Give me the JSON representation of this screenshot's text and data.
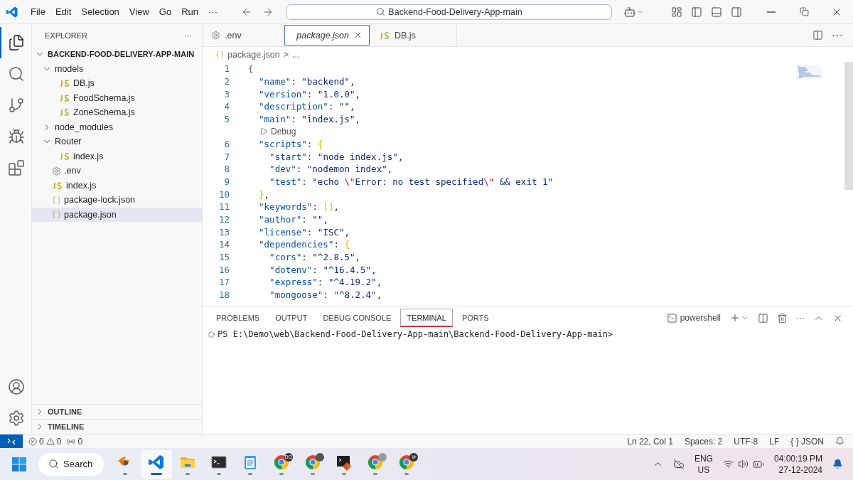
{
  "title_bar": {
    "menu": [
      "File",
      "Edit",
      "Selection",
      "View",
      "Go",
      "Run",
      "···"
    ],
    "search": {
      "value": "Backend-Food-Delivery-App-main"
    }
  },
  "activity_bar": {
    "items": [
      {
        "kind": "files",
        "selected": true
      },
      {
        "kind": "search",
        "selected": false
      },
      {
        "kind": "source-control",
        "selected": false
      },
      {
        "kind": "run-debug",
        "selected": false
      },
      {
        "kind": "extensions",
        "selected": false
      }
    ],
    "bottom": [
      {
        "kind": "account"
      },
      {
        "kind": "settings"
      }
    ]
  },
  "sidebar": {
    "title": "EXPLORER",
    "more": "···",
    "tree": [
      {
        "label": "BACKEND-FOOD-DELIVERY-APP-MAIN",
        "kind": "root",
        "expanded": true,
        "children": [
          {
            "label": "models",
            "kind": "folder",
            "expanded": true,
            "children": [
              {
                "label": "DB.js",
                "kind": "js",
                "selected": false
              },
              {
                "label": "FoodSchema.js",
                "kind": "js",
                "selected": false
              },
              {
                "label": "ZoneSchema.js",
                "kind": "js",
                "selected": false
              }
            ]
          },
          {
            "label": "node_modules",
            "kind": "folder",
            "expanded": false
          },
          {
            "label": "Router",
            "kind": "folder",
            "expanded": true,
            "children": [
              {
                "label": "index.js",
                "kind": "js",
                "selected": false
              }
            ]
          },
          {
            "label": ".env",
            "kind": "env",
            "selected": false
          },
          {
            "label": "index.js",
            "kind": "js",
            "selected": false
          },
          {
            "label": "package-lock.json",
            "kind": "json",
            "selected": false
          },
          {
            "label": "package.json",
            "kind": "json",
            "selected": true
          }
        ]
      }
    ],
    "sections": [
      {
        "label": "OUTLINE",
        "expanded": false
      },
      {
        "label": "TIMELINE",
        "expanded": false
      }
    ]
  },
  "tabs": [
    {
      "label": ".env",
      "kind": "env",
      "selected": false,
      "preview": false
    },
    {
      "label": "package.json",
      "kind": "json",
      "selected": true,
      "preview": true
    },
    {
      "label": "DB.js",
      "kind": "js",
      "selected": false,
      "preview": false
    }
  ],
  "tab_bar_more": "···",
  "breadcrumb": {
    "file": "package.json",
    "separator": ">",
    "rest": "..."
  },
  "code": [
    {
      "kind": "line",
      "number": "1",
      "tokens": [
        {
          "text": "{",
          "kind": "root"
        }
      ]
    },
    {
      "kind": "line",
      "number": "2",
      "tokens": [
        {
          "text": "  \"name\"",
          "kind": "key"
        },
        {
          "text": ": ",
          "kind": "punct"
        },
        {
          "text": "\"backend\"",
          "kind": "str"
        },
        {
          "text": ",",
          "kind": "punct"
        }
      ]
    },
    {
      "kind": "line",
      "number": "3",
      "tokens": [
        {
          "text": "  \"version\"",
          "kind": "key"
        },
        {
          "text": ": ",
          "kind": "punct"
        },
        {
          "text": "\"1.0.0\"",
          "kind": "str"
        },
        {
          "text": ",",
          "kind": "punct"
        }
      ]
    },
    {
      "kind": "line",
      "number": "4",
      "tokens": [
        {
          "text": "  \"description\"",
          "kind": "key"
        },
        {
          "text": ": ",
          "kind": "punct"
        },
        {
          "text": "\"\"",
          "kind": "str"
        },
        {
          "text": ",",
          "kind": "punct"
        }
      ]
    },
    {
      "kind": "line",
      "number": "5",
      "tokens": [
        {
          "text": "  \"main\"",
          "kind": "key"
        },
        {
          "text": ": ",
          "kind": "punct"
        },
        {
          "text": "\"index.js\"",
          "kind": "str"
        },
        {
          "text": ",",
          "kind": "punct"
        }
      ]
    },
    {
      "kind": "codelens",
      "label": "Debug"
    },
    {
      "kind": "line",
      "number": "6",
      "tokens": [
        {
          "text": "  \"scripts\"",
          "kind": "key"
        },
        {
          "text": ": ",
          "kind": "punct"
        },
        {
          "text": "{",
          "kind": "brace"
        }
      ]
    },
    {
      "kind": "line",
      "number": "7",
      "tokens": [
        {
          "text": "    \"start\"",
          "kind": "key"
        },
        {
          "text": ": ",
          "kind": "punct"
        },
        {
          "text": "\"node index.js\"",
          "kind": "str"
        },
        {
          "text": ",",
          "kind": "punct"
        }
      ]
    },
    {
      "kind": "line",
      "number": "8",
      "tokens": [
        {
          "text": "    \"dev\"",
          "kind": "key"
        },
        {
          "text": ": ",
          "kind": "punct"
        },
        {
          "text": "\"nodemon index\"",
          "kind": "str"
        },
        {
          "text": ",",
          "kind": "punct"
        }
      ]
    },
    {
      "kind": "line",
      "number": "9",
      "tokens": [
        {
          "text": "    \"test\"",
          "kind": "key"
        },
        {
          "text": ": ",
          "kind": "punct"
        },
        {
          "text": "\"echo ",
          "kind": "str"
        },
        {
          "text": "\\\"",
          "kind": "esc"
        },
        {
          "text": "Error: no test specified",
          "kind": "str"
        },
        {
          "text": "\\\"",
          "kind": "esc"
        },
        {
          "text": " && exit 1\"",
          "kind": "str"
        }
      ]
    },
    {
      "kind": "line",
      "number": "10",
      "tokens": [
        {
          "text": "  }",
          "kind": "brace"
        },
        {
          "text": ",",
          "kind": "punct"
        }
      ]
    },
    {
      "kind": "line",
      "number": "11",
      "tokens": [
        {
          "text": "  \"keywords\"",
          "kind": "key"
        },
        {
          "text": ": ",
          "kind": "punct"
        },
        {
          "text": "[]",
          "kind": "brace"
        },
        {
          "text": ",",
          "kind": "punct"
        }
      ]
    },
    {
      "kind": "line",
      "number": "12",
      "tokens": [
        {
          "text": "  \"author\"",
          "kind": "key"
        },
        {
          "text": ": ",
          "kind": "punct"
        },
        {
          "text": "\"\"",
          "kind": "str"
        },
        {
          "text": ",",
          "kind": "punct"
        }
      ]
    },
    {
      "kind": "line",
      "number": "13",
      "tokens": [
        {
          "text": "  \"license\"",
          "kind": "key"
        },
        {
          "text": ": ",
          "kind": "punct"
        },
        {
          "text": "\"ISC\"",
          "kind": "str"
        },
        {
          "text": ",",
          "kind": "punct"
        }
      ]
    },
    {
      "kind": "line",
      "number": "14",
      "tokens": [
        {
          "text": "  \"dependencies\"",
          "kind": "key"
        },
        {
          "text": ": ",
          "kind": "punct"
        },
        {
          "text": "{",
          "kind": "brace"
        }
      ]
    },
    {
      "kind": "line",
      "number": "15",
      "tokens": [
        {
          "text": "    \"cors\"",
          "kind": "key"
        },
        {
          "text": ": ",
          "kind": "punct"
        },
        {
          "text": "\"^2.8.5\"",
          "kind": "str"
        },
        {
          "text": ",",
          "kind": "punct"
        }
      ]
    },
    {
      "kind": "line",
      "number": "16",
      "tokens": [
        {
          "text": "    \"dotenv\"",
          "kind": "key"
        },
        {
          "text": ": ",
          "kind": "punct"
        },
        {
          "text": "\"^16.4.5\"",
          "kind": "str"
        },
        {
          "text": ",",
          "kind": "punct"
        }
      ]
    },
    {
      "kind": "line",
      "number": "17",
      "tokens": [
        {
          "text": "    \"express\"",
          "kind": "key"
        },
        {
          "text": ": ",
          "kind": "punct"
        },
        {
          "text": "\"^4.19.2\"",
          "kind": "str"
        },
        {
          "text": ",",
          "kind": "punct"
        }
      ]
    },
    {
      "kind": "line",
      "number": "18",
      "tokens": [
        {
          "text": "    \"mongoose\"",
          "kind": "key"
        },
        {
          "text": ": ",
          "kind": "punct"
        },
        {
          "text": "\"^8.2.4\"",
          "kind": "str"
        },
        {
          "text": ",",
          "kind": "punct"
        }
      ]
    }
  ],
  "panel": {
    "tabs": [
      {
        "label": "PROBLEMS",
        "selected": false
      },
      {
        "label": "OUTPUT",
        "selected": false
      },
      {
        "label": "DEBUG CONSOLE",
        "selected": false
      },
      {
        "label": "TERMINAL",
        "selected": true
      },
      {
        "label": "PORTS",
        "selected": false
      }
    ],
    "shell": "powershell",
    "more": "···",
    "prompt": "PS E:\\Demo\\web\\Backend-Food-Delivery-App-main\\Backend-Food-Delivery-App-main>"
  },
  "status_bar": {
    "errors": "0",
    "warnings": "0",
    "ports": "0",
    "right": [
      "Ln 22, Col 1",
      "Spaces: 2",
      "UTF-8",
      "LF",
      "{ } JSON"
    ]
  },
  "taskbar": {
    "search": "Search",
    "apps": [
      {
        "kind": "blender",
        "selected": false
      },
      {
        "kind": "vscode",
        "selected": true
      },
      {
        "kind": "files",
        "selected": false
      },
      {
        "kind": "terminal",
        "selected": false
      },
      {
        "kind": "notepad",
        "selected": false
      },
      {
        "kind": "chrome",
        "selected": false,
        "badge": {
          "kind": "text",
          "text": "DG"
        }
      },
      {
        "kind": "chrome",
        "selected": false,
        "badge": {
          "kind": "dots"
        }
      },
      {
        "kind": "gitbash",
        "selected": false
      },
      {
        "kind": "chrome",
        "selected": false,
        "badge": {
          "kind": "figure"
        }
      },
      {
        "kind": "chrome",
        "selected": false,
        "badge": {
          "kind": "text",
          "text": "Vr"
        }
      }
    ],
    "language": "ENG",
    "region": "US",
    "time": "04:00:19 PM",
    "date": "27-12-2024"
  }
}
